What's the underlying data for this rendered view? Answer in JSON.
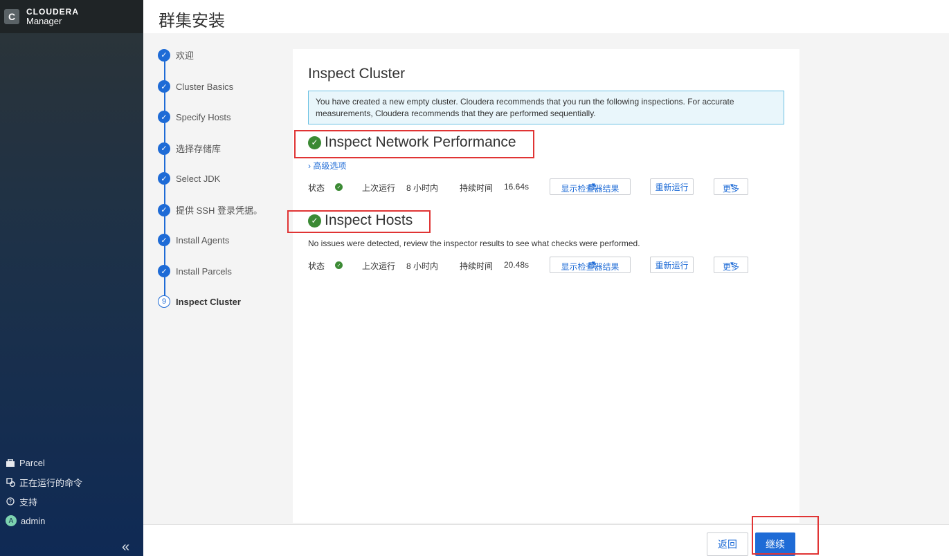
{
  "app": {
    "brand_line1": "CLOUDERA",
    "brand_line2": "Manager",
    "logo_letter": "C"
  },
  "header": {
    "title": "群集安装"
  },
  "sidebar": {
    "links": [
      {
        "label": "Parcel",
        "icon": "parcel-icon"
      },
      {
        "label": "正在运行的命令",
        "icon": "running-commands-icon"
      },
      {
        "label": "支持",
        "icon": "help-icon"
      },
      {
        "label": "admin",
        "icon": "avatar",
        "avatar_letter": "A"
      }
    ],
    "collapse_glyph": "«"
  },
  "steps": [
    {
      "label": "欢迎",
      "state": "done"
    },
    {
      "label": "Cluster Basics",
      "state": "done"
    },
    {
      "label": "Specify Hosts",
      "state": "done"
    },
    {
      "label": "选择存储库",
      "state": "done"
    },
    {
      "label": "Select JDK",
      "state": "done"
    },
    {
      "label": "提供 SSH 登录凭据。",
      "state": "done"
    },
    {
      "label": "Install Agents",
      "state": "done"
    },
    {
      "label": "Install Parcels",
      "state": "done"
    },
    {
      "label": "Inspect Cluster",
      "state": "current",
      "number": "9"
    }
  ],
  "main": {
    "title": "Inspect Cluster",
    "alert": "You have created a new empty cluster. Cloudera recommends that you run the following inspections. For accurate measurements, Cloudera recommends that they are performed sequentially.",
    "network": {
      "title": "Inspect Network Performance",
      "advanced_link": "高级选项",
      "status_label": "状态",
      "last_run_label": "上次运行",
      "last_run_value": "8 小时内",
      "duration_label": "持续时间",
      "duration_value": "16.64s",
      "show_results": "显示检查器结果",
      "rerun": "重新运行",
      "more": "更多"
    },
    "hosts": {
      "title": "Inspect Hosts",
      "description": "No issues were detected, review the inspector results to see what checks were performed.",
      "status_label": "状态",
      "last_run_label": "上次运行",
      "last_run_value": "8 小时内",
      "duration_label": "持续时间",
      "duration_value": "20.48s",
      "show_results": "显示检查器结果",
      "rerun": "重新运行",
      "more": "更多"
    }
  },
  "footer": {
    "back": "返回",
    "continue": "继续"
  },
  "colors": {
    "accent": "#1e6bd6",
    "success": "#3b8a34",
    "highlight": "#e03434"
  }
}
